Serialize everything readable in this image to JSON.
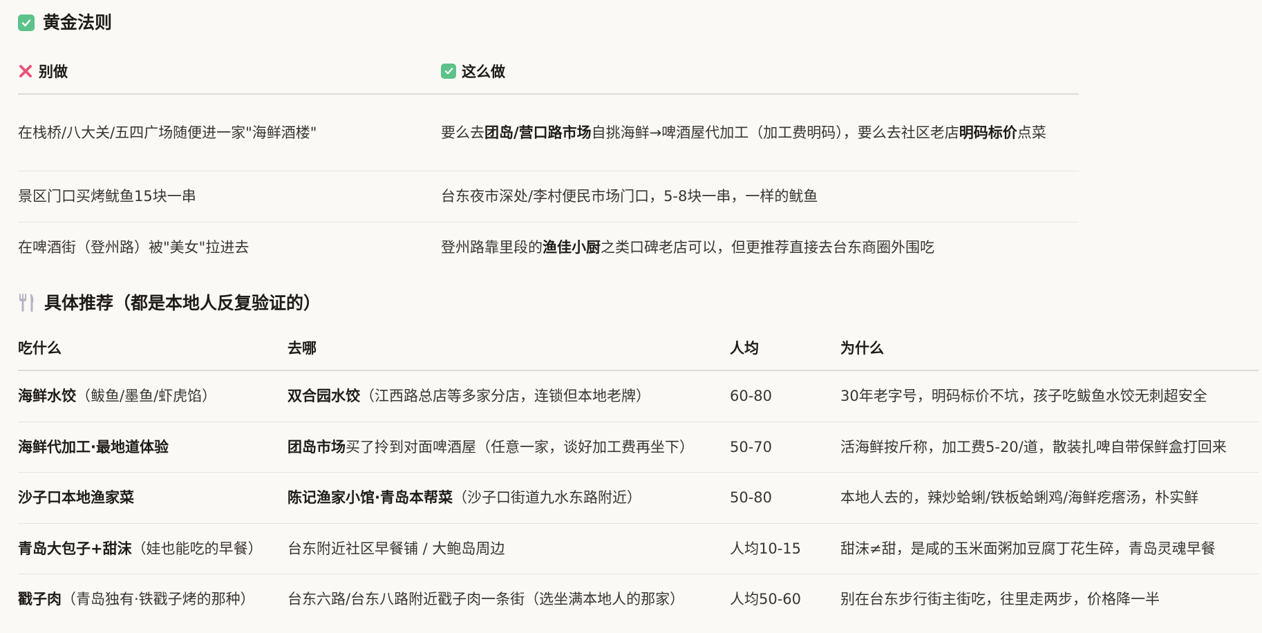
{
  "section1": {
    "title": "黄金法则",
    "col_dont": "别做",
    "col_do": "这么做",
    "rows": [
      {
        "dont": "在栈桥/八大关/五四广场随便进一家\"海鲜酒楼\"",
        "do_parts": [
          "要么去",
          "团岛/营口路市场",
          "自挑海鲜→啤酒屋代加工（加工费明码），要么去社区老店",
          "明码标价",
          "点菜"
        ]
      },
      {
        "dont": "景区门口买烤鱿鱼15块一串",
        "do_parts": [
          "台东夜市深处/李村便民市场门口，5-8块一串，一样的鱿鱼"
        ]
      },
      {
        "dont": "在啤酒街（登州路）被\"美女\"拉进去",
        "do_parts": [
          "登州路靠里段的",
          "渔佳小厨",
          "之类口碑老店可以，但更推荐直接去台东商圈外围吃"
        ]
      }
    ]
  },
  "section2": {
    "title": "具体推荐（都是本地人反复验证的）",
    "headers": [
      "吃什么",
      "去哪",
      "人均",
      "为什么"
    ],
    "rows": [
      {
        "what_bold": "海鲜水饺",
        "what_rest": "（鲅鱼/墨鱼/虾虎馅）",
        "where_bold": "双合园水饺",
        "where_rest": "（江西路总店等多家分店，连锁但本地老牌）",
        "price": "60-80",
        "why": "30年老字号，明码标价不坑，孩子吃鲅鱼水饺无刺超安全"
      },
      {
        "what_bold": "海鲜代加工·最地道体验",
        "what_rest": "",
        "where_bold": "团岛市场",
        "where_rest": "买了拎到对面啤酒屋（任意一家，谈好加工费再坐下）",
        "price": "50-70",
        "why": "活海鲜按斤称，加工费5-20/道，散装扎啤自带保鲜盒打回来"
      },
      {
        "what_bold": "沙子口本地渔家菜",
        "what_rest": "",
        "where_bold": "陈记渔家小馆·青岛本帮菜",
        "where_rest": "（沙子口街道九水东路附近）",
        "price": "50-80",
        "why": "本地人去的，辣炒蛤蜊/铁板蛤蜊鸡/海鲜疙瘩汤，朴实鲜"
      },
      {
        "what_bold": "青岛大包子+甜沫",
        "what_rest": "（娃也能吃的早餐）",
        "where_bold": "",
        "where_rest": "台东附近社区早餐铺 / 大鲍岛周边",
        "price": "人均10-15",
        "why": "甜沫≠甜，是咸的玉米面粥加豆腐丁花生碎，青岛灵魂早餐"
      },
      {
        "what_bold": "戳子肉",
        "what_rest": "（青岛独有·铁戳子烤的那种）",
        "where_bold": "",
        "where_rest": "台东六路/台东八路附近戳子肉一条街（选坐满本地人的那家）",
        "price": "人均50-60",
        "why": "别在台东步行街主街吃，往里走两步，价格降一半"
      }
    ]
  },
  "colors": {
    "check_green": "#5cc28a",
    "cross_pink": "#e8557a"
  },
  "icons": [
    "check-icon",
    "cross-icon",
    "fork-knife-icon"
  ]
}
